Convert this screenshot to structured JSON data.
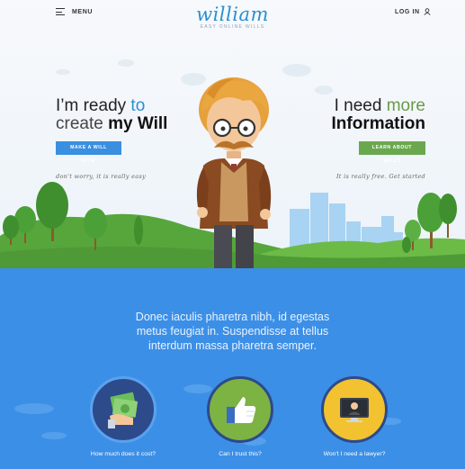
{
  "nav": {
    "menu_label": "MENU",
    "login_label": "LOG IN"
  },
  "logo": {
    "name": "william",
    "tagline": "EASY ONLINE WILLS"
  },
  "left": {
    "line1_a": "I’m ready",
    "line1_b": " to",
    "line2_a": "create ",
    "line2_b": "my Will",
    "button": "MAKE A WILL NOW",
    "script": "don't worry, it is really easy"
  },
  "right": {
    "line1_a": "I need ",
    "line1_b": "more",
    "line2": "Information",
    "button": "LEARN ABOUT WILLS",
    "script": "It is really free. Get started"
  },
  "intro": {
    "line1": "Donec iaculis pharetra nibh, id egestas",
    "line2": "metus feugiat in. Suspendisse at tellus",
    "line3": "interdum massa pharetra semper."
  },
  "features": [
    {
      "label": "How much does it cost?",
      "icon": "money-hand-icon",
      "color": "#2d4a8a"
    },
    {
      "label": "Can I trust this?",
      "icon": "thumbs-up-icon",
      "color": "#7cb342"
    },
    {
      "label": "Won't I need a lawyer?",
      "icon": "video-call-icon",
      "color": "#f2c230"
    }
  ],
  "colors": {
    "brand_blue": "#2a8fd1",
    "section_blue": "#3c8fe6",
    "button_blue": "#3a8fe0",
    "button_green": "#6aa84f",
    "grass": "#5fae3e"
  }
}
